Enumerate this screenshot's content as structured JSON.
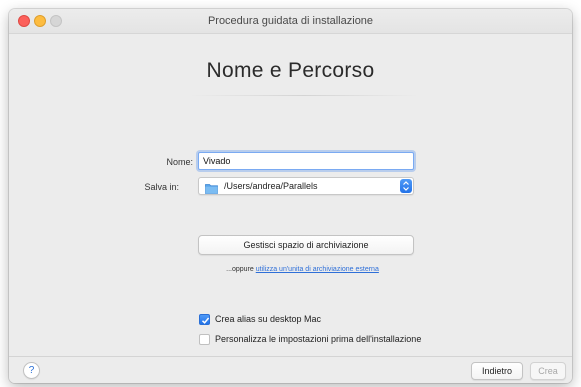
{
  "window": {
    "title": "Procedura guidata di installazione"
  },
  "page": {
    "heading": "Nome e Percorso"
  },
  "form": {
    "name_label": "Nome:",
    "name_value": "Vivado",
    "save_label": "Salva in:",
    "save_path": "/Users/andrea/Parallels",
    "manage_storage_button": "Gestisci spazio di archiviazione",
    "alt_prefix": "...oppure ",
    "alt_link": "utilizza un'unita di archiviazione esterna"
  },
  "options": [
    {
      "label": "Crea alias su desktop Mac",
      "checked": true
    },
    {
      "label": "Personalizza le impostazioni prima dell'installazione",
      "checked": false
    }
  ],
  "footer": {
    "help": "?",
    "back_button": "Indietro",
    "create_button": "Crea"
  },
  "colors": {
    "accent": "#2373e8",
    "link": "#2e6fd8",
    "close": "#fc605b",
    "minimize": "#fdbc40"
  },
  "icons": [
    "folder-icon",
    "chevron-updown-icon",
    "checkmark-icon",
    "help-icon"
  ]
}
